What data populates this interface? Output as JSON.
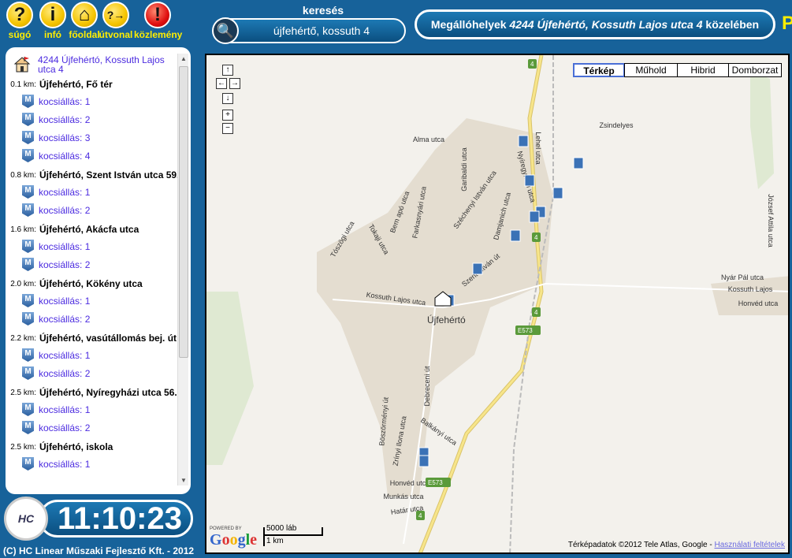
{
  "toolbar": [
    {
      "icon": "help-icon",
      "glyph": "?",
      "label": "súgó"
    },
    {
      "icon": "info-icon",
      "glyph": "i",
      "label": "infó"
    },
    {
      "icon": "home-icon",
      "glyph": "⌂",
      "label": "főoldal"
    },
    {
      "icon": "route-icon",
      "glyph": "?→",
      "label": "útvonal"
    },
    {
      "icon": "alert-icon",
      "glyph": "!",
      "label": "közlemény"
    }
  ],
  "search": {
    "label": "keresés",
    "value": "újfehértő, kossuth 4"
  },
  "header": {
    "prefix": "Megállóhelyek ",
    "place": "4244 Újfehértó, Kossuth Lajos utca 4",
    "suffix": " közelében",
    "cut_text": "P"
  },
  "list": {
    "origin": "4244 Újfehértó, Kossuth Lajos utca 4",
    "stops": [
      {
        "dist": "0.1 km:",
        "name": "Újfehértó, Fő tér",
        "bays": [
          "kocsiállás: 1",
          "kocsiállás: 2",
          "kocsiállás: 3",
          "kocsiállás: 4"
        ]
      },
      {
        "dist": "0.8 km:",
        "name": "Újfehértó, Szent István utca 59.",
        "bays": [
          "kocsiállás: 1",
          "kocsiállás: 2"
        ]
      },
      {
        "dist": "1.6 km:",
        "name": "Újfehértó, Akácfa utca",
        "bays": [
          "kocsiállás: 1",
          "kocsiállás: 2"
        ]
      },
      {
        "dist": "2.0 km:",
        "name": "Újfehértó, Kökény utca",
        "bays": [
          "kocsiállás: 1",
          "kocsiállás: 2"
        ]
      },
      {
        "dist": "2.2 km:",
        "name": "Újfehértó, vasútállomás bej. út",
        "bays": [
          "kocsiállás: 1",
          "kocsiállás: 2"
        ]
      },
      {
        "dist": "2.5 km:",
        "name": "Újfehértó, Nyíregyházi utca 56.",
        "bays": [
          "kocsiállás: 1",
          "kocsiállás: 2"
        ]
      },
      {
        "dist": "2.5 km:",
        "name": "Újfehértó, iskola",
        "bays": [
          "kocsiállás: 1"
        ]
      }
    ]
  },
  "clock": {
    "logo": "HC Linear",
    "time": "11:10:23"
  },
  "footer": {
    "copyright": "(C) HC Linear Műszaki Fejlesztő Kft. - 2012"
  },
  "map": {
    "types": [
      "Térkép",
      "Műhold",
      "Hibrid",
      "Domborzat"
    ],
    "selected_type": "Térkép",
    "town": "Újfehértó",
    "streets": [
      "Alma utca",
      "Lehel utca",
      "Nyíregyházi utca",
      "Garibaldi utca",
      "Bem apó utca",
      "Farkasnyári utca",
      "Széchenyi István utca",
      "Damjanich utca",
      "Tokaji utca",
      "Tószögi utca",
      "Szent István út",
      "Kossuth Lajos utca",
      "Debreceni út",
      "Böszörményi út",
      "Zrínyi Ilona utca",
      "Balkányi utca",
      "Honvéd utca",
      "Munkás utca",
      "Határ utca",
      "Zsindelyes",
      "József Attila utca",
      "Nyár Pál utca",
      "Kossuth Lajos",
      "Honvéd utca"
    ],
    "road_shields": [
      "4",
      "E573"
    ],
    "powered_by": "POWERED BY",
    "google": "Google",
    "scale_ft": "5000 láb",
    "scale_km": "1 km",
    "attribution": "Térképadatok ©2012 Tele Atlas, Google - ",
    "terms_link": "Használati feltételek",
    "colors": {
      "background": "#f3f1ec",
      "town": "#e4ddd0",
      "highway": "#f7e58a",
      "park": "#d6e5c8"
    }
  }
}
